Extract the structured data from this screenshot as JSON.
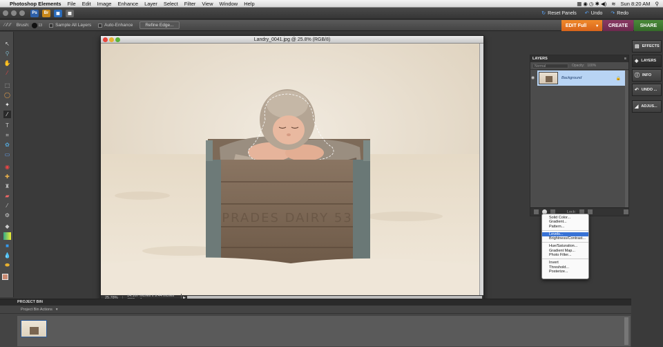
{
  "menubar": {
    "app": "Photoshop Elements",
    "items": [
      "File",
      "Edit",
      "Image",
      "Enhance",
      "Layer",
      "Select",
      "Filter",
      "View",
      "Window",
      "Help"
    ],
    "clock": "Sun 8:20 AM"
  },
  "appbar": {
    "reset_panels": "Reset Panels",
    "undo": "Undo",
    "redo": "Redo",
    "icon_ps": "Ps",
    "icon_org": "Br"
  },
  "options": {
    "brush_label": "Brush:",
    "brush_size": "13",
    "sample_all": "Sample All Layers",
    "auto_enhance": "Auto-Enhance",
    "refine_edge": "Refine Edge..."
  },
  "modes": {
    "edit": "EDIT Full",
    "create": "CREATE",
    "share": "SHARE"
  },
  "document": {
    "title": "Landry_0041.jpg @ 25.8% (RGB/8)",
    "zoom": "25.78%",
    "dimensions": "14.167 inches x 9.44 inches (300 ppi)",
    "crate_text": "PRADES DAIRY 53"
  },
  "layers": {
    "title": "LAYERS",
    "blend_mode": "Normal",
    "opacity_label": "Opacity:",
    "opacity_value": "100%",
    "layer_name": "Background",
    "lock_label": "Lock:"
  },
  "side_tabs": [
    "EFFECTS",
    "LAYERS",
    "INFO",
    "UNDO ...",
    "ADJUS..."
  ],
  "adjust_menu": {
    "group1": [
      "Solid Color...",
      "Gradient...",
      "Pattern..."
    ],
    "group2": [
      "Levels...",
      "Brightness/Contrast..."
    ],
    "group3": [
      "Hue/Saturation...",
      "Gradient Map...",
      "Photo Filter..."
    ],
    "group4": [
      "Invert",
      "Threshold...",
      "Posterize..."
    ],
    "highlighted": "Levels..."
  },
  "project_bin": {
    "title": "PROJECT BIN",
    "actions": "Project Bin Actions"
  },
  "colors": {
    "accent_edit": "#e8741f",
    "create": "#7a3258",
    "share": "#3e7a30",
    "selection": "#3873d6"
  }
}
